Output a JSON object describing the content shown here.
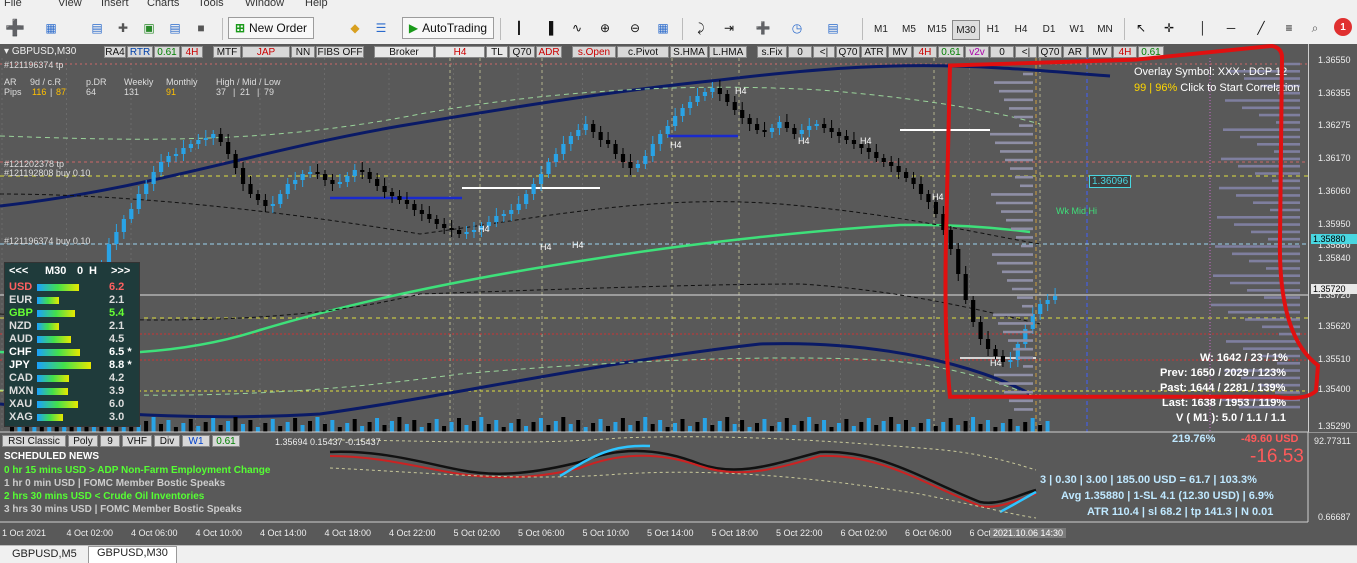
{
  "menu": [
    "File",
    "View",
    "Insert",
    "Charts",
    "Tools",
    "Window",
    "Help"
  ],
  "toolbar": {
    "new_order": "New Order",
    "autotrading": "AutoTrading",
    "timeframes": [
      "M1",
      "M5",
      "M15",
      "M30",
      "H1",
      "H4",
      "D1",
      "W1",
      "MN"
    ],
    "active_timeframe": "M30",
    "notification_count": "1"
  },
  "chart": {
    "symbol_label": "GBPUSD,M30",
    "header_buttons": [
      "RA4",
      "RTR",
      "0.61",
      "4H",
      "MTF",
      "JAP",
      "NN",
      "FIBS OFF",
      "Broker",
      "H4",
      "TL",
      "Q70",
      "ADR",
      "s.Open",
      "c.Pivot",
      "S.HMA",
      "L.HMA",
      "s.Fix",
      "0",
      "<|",
      "Q70",
      "ATR",
      "MV",
      "4H",
      "0.61",
      "v2v",
      "0",
      "<|",
      "Q70",
      "AR",
      "MV",
      "4H",
      "0.61"
    ],
    "order_lines": [
      "#121196374 tp",
      "#121202378 tp",
      "#121192808 buy 0.10",
      "#121196374 buy 0.10"
    ],
    "stats_header": {
      "ar": "AR",
      "d9": "9d / c.R",
      "pdr": "p.DR",
      "weekly": "Weekly",
      "monthly": "Monthly",
      "hml": "High / Mid / Low",
      "pips": "Pips",
      "v116": "116",
      "v87": "87",
      "v64": "64",
      "v131": "131",
      "v91": "91",
      "v37": "37",
      "v21": "21",
      "v79": "79"
    },
    "overlay": {
      "symbol": "Overlay Symbol: XXX : DCP 12",
      "corr_values": "99 | 96%",
      "corr_link": "Click to Start Correlation"
    },
    "wk_label": "Wk Mid Hi",
    "price_tag": "1.36096",
    "prices": [
      "1.36550",
      "1.36355",
      "1.36275",
      "1.36170",
      "1.36060",
      "1.35950",
      "1.35880",
      "1.35840",
      "1.35720",
      "1.35620",
      "1.35510",
      "1.35400",
      "1.35290",
      "1.36096",
      "1.35880",
      "1.35720"
    ],
    "pivot_labels": [
      "H4",
      "H4",
      "H4",
      "H4",
      "H4",
      "H4",
      "H4",
      "H4"
    ],
    "stats_box": {
      "w": "W: 1642 / 23 / 1%",
      "prev": "Prev: 1650 / 2029 / 123%",
      "past": "Past: 1644 / 2281 / 139%",
      "last": "Last: 1638 / 1953 / 119%",
      "v": "V ( M1 ): 5.0 / 1.1 / 1.1"
    },
    "currency_panel": {
      "header": [
        "<<<",
        "M30",
        "0",
        "H",
        ">>>"
      ],
      "rows": [
        {
          "ccy": "USD",
          "val": "6.2",
          "color": "#ff6060",
          "mark": ""
        },
        {
          "ccy": "EUR",
          "val": "2.1",
          "color": "#dddddd",
          "mark": ""
        },
        {
          "ccy": "GBP",
          "val": "5.4",
          "color": "#66ff33",
          "mark": ""
        },
        {
          "ccy": "NZD",
          "val": "2.1",
          "color": "#dddddd",
          "mark": ""
        },
        {
          "ccy": "AUD",
          "val": "4.5",
          "color": "#dddddd",
          "mark": ""
        },
        {
          "ccy": "CHF",
          "val": "6.5",
          "color": "#ffffff",
          "mark": "*"
        },
        {
          "ccy": "JPY",
          "val": "8.8",
          "color": "#ffffff",
          "mark": "*"
        },
        {
          "ccy": "CAD",
          "val": "4.2",
          "color": "#dddddd",
          "mark": ""
        },
        {
          "ccy": "MXN",
          "val": "3.9",
          "color": "#dddddd",
          "mark": ""
        },
        {
          "ccy": "XAU",
          "val": "6.0",
          "color": "#dddddd",
          "mark": ""
        },
        {
          "ccy": "XAG",
          "val": "3.0",
          "color": "#dddddd",
          "mark": ""
        }
      ],
      "bar_levels": [
        0.62,
        0.21,
        0.54,
        0.21,
        0.45,
        0.65,
        0.88,
        0.42,
        0.39,
        0.6,
        0.3
      ]
    }
  },
  "subwindow": {
    "buttons": [
      "RSI Classic",
      "Poly",
      "9",
      "VHF",
      "Div",
      "W1",
      "0.61"
    ],
    "readout": "1.35694 0.15437 -0.15437",
    "news_title": "SCHEDULED NEWS",
    "news": [
      {
        "text": "0 hr 15 mins  USD  >  ADP Non-Farm Employment Change",
        "color": "#55ff33"
      },
      {
        "text": "1 hr 0 min  USD  |  FOMC Member Bostic Speaks",
        "color": "#cccccc"
      },
      {
        "text": "2 hrs 30 mins  USD  <  Crude Oil Inventories",
        "color": "#55ff33"
      },
      {
        "text": "3 hrs 30 mins  USD  |  FOMC Member Bostic Speaks",
        "color": "#cccccc"
      }
    ],
    "account": {
      "pct": "219.76%",
      "pnl": "-49.60 USD",
      "big": "-16.53",
      "line1": "3  |  0.30  |  3.00  |  185.00 USD = 61.7  |  103.3%",
      "line2": "Avg 1.35880  |  1-SL 4.1 (12.30 USD)  |  6.9%",
      "line3": "ATR 110.4  |  sl 68.2  |  tp 141.3  |  N 0.01"
    },
    "scale": [
      "92.77311",
      "0.66687"
    ]
  },
  "time_axis": [
    "1 Oct 2021",
    "4 Oct 02:00",
    "4 Oct 06:00",
    "4 Oct 10:00",
    "4 Oct 14:00",
    "4 Oct 18:00",
    "4 Oct 22:00",
    "5 Oct 02:00",
    "5 Oct 06:00",
    "5 Oct 10:00",
    "5 Oct 14:00",
    "5 Oct 18:00",
    "5 Oct 22:00",
    "6 Oct 02:00",
    "6 Oct 06:00",
    "6 Oct 1"
  ],
  "time_cursor": "2021.10.06 14:30",
  "tabs": [
    "GBPUSD,M5",
    "GBPUSD,M30"
  ],
  "colors": {
    "bg": "#595959",
    "bull": "#29a3e6",
    "bear": "#000000",
    "ma_green": "#3ee07a",
    "ma_navy": "#0a1a66",
    "red_frame": "#e01010"
  }
}
